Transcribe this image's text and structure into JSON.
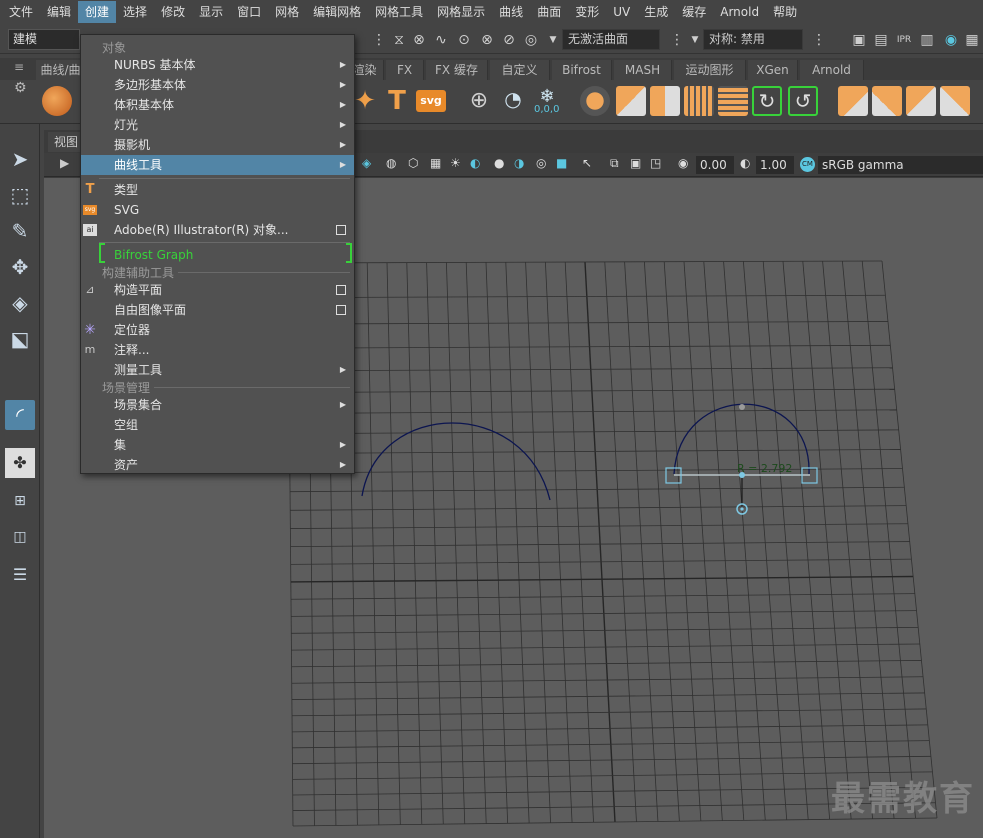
{
  "menubar": {
    "items": [
      "文件",
      "编辑",
      "创建",
      "选择",
      "修改",
      "显示",
      "窗口",
      "网格",
      "编辑网格",
      "网格工具",
      "网格显示",
      "曲线",
      "曲面",
      "变形",
      "UV",
      "生成",
      "缓存",
      "Arnold",
      "帮助"
    ],
    "active_index": 2
  },
  "statusline": {
    "mode": "建模",
    "live_surface": "无激活曲面",
    "symmetry": "对称: 禁用"
  },
  "shelf": {
    "tabs": [
      "曲线/曲面",
      "渲染",
      "FX",
      "FX 缓存",
      "自定义",
      "Bifrost",
      "MASH",
      "运动图形",
      "XGen",
      "Arnold"
    ],
    "text_icon": "T",
    "svg_icon": "svg",
    "coord_label": "0,0,0"
  },
  "viewport": {
    "tab_label": "视图",
    "exposure": "0.00",
    "gamma": "1.00",
    "colorspace": "sRGB gamma",
    "radius_label": "R = 2.792",
    "watermark": "最需教育"
  },
  "create_menu": {
    "section_objects": "对象",
    "items_objects": [
      {
        "label": "NURBS 基本体",
        "submenu": true
      },
      {
        "label": "多边形基本体",
        "submenu": true
      },
      {
        "label": "体积基本体",
        "submenu": true
      },
      {
        "label": "灯光",
        "submenu": true
      },
      {
        "label": "摄影机",
        "submenu": true
      },
      {
        "label": "曲线工具",
        "submenu": true,
        "highlighted": true
      }
    ],
    "items_type": [
      {
        "label": "类型",
        "icon": "T"
      },
      {
        "label": "SVG",
        "icon": "svg"
      },
      {
        "label": "Adobe(R) Illustrator(R) 对象...",
        "icon": "ai",
        "option_box": true
      }
    ],
    "bifrost": "Bifrost Graph",
    "section_construction": "构建辅助工具",
    "items_construction": [
      {
        "label": "构造平面",
        "option_box": true
      },
      {
        "label": "自由图像平面",
        "option_box": true
      },
      {
        "label": "定位器",
        "icon": "✳"
      },
      {
        "label": "注释...",
        "icon": "m"
      },
      {
        "label": "测量工具",
        "submenu": true
      }
    ],
    "section_scene": "场景管理",
    "items_scene": [
      {
        "label": "场景集合",
        "submenu": true
      },
      {
        "label": "空组"
      },
      {
        "label": "集",
        "submenu": true
      },
      {
        "label": "资产",
        "submenu": true
      }
    ]
  },
  "colors": {
    "highlight": "#5285a6",
    "bifrost_green": "#38d23a",
    "curve": "#0c1550",
    "manipulator": "#7ec8e3"
  }
}
